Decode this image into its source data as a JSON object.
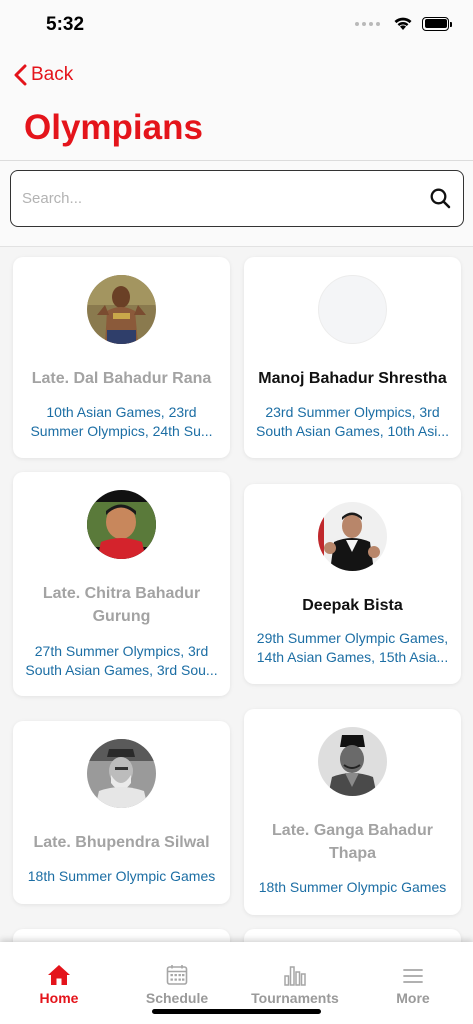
{
  "status": {
    "time": "5:32"
  },
  "header": {
    "back_label": "Back",
    "title": "Olympians"
  },
  "search": {
    "placeholder": "Search..."
  },
  "olympians": [
    {
      "name": "Late. Dal Bahadur Rana",
      "games": "10th Asian Games, 23rd Summer  Olympics, 24th Su...",
      "late": true
    },
    {
      "name": "Manoj Bahadur Shrestha",
      "games": "23rd Summer  Olympics, 3rd South Asian Games, 10th Asi...",
      "late": false
    },
    {
      "name": "Late. Chitra Bahadur Gurung",
      "games": "27th Summer Olympics, 3rd South Asian Games, 3rd Sou...",
      "late": true
    },
    {
      "name": "Deepak Bista",
      "games": "29th Summer Olympic Games, 14th Asian Games, 15th Asia...",
      "late": false
    },
    {
      "name": "Late. Bhupendra Silwal",
      "games": "18th Summer Olympic Games",
      "late": true
    },
    {
      "name": "Late. Ganga Bahadur Thapa",
      "games": "18th Summer Olympic Games",
      "late": true
    }
  ],
  "tabs": [
    {
      "label": "Home",
      "icon": "home-icon",
      "active": true
    },
    {
      "label": "Schedule",
      "icon": "calendar-icon",
      "active": false
    },
    {
      "label": "Tournaments",
      "icon": "bar-chart-icon",
      "active": false
    },
    {
      "label": "More",
      "icon": "menu-icon",
      "active": false
    }
  ],
  "colors": {
    "accent": "#e4141b",
    "link": "#1c6ea4",
    "muted": "#a3a3a3"
  }
}
